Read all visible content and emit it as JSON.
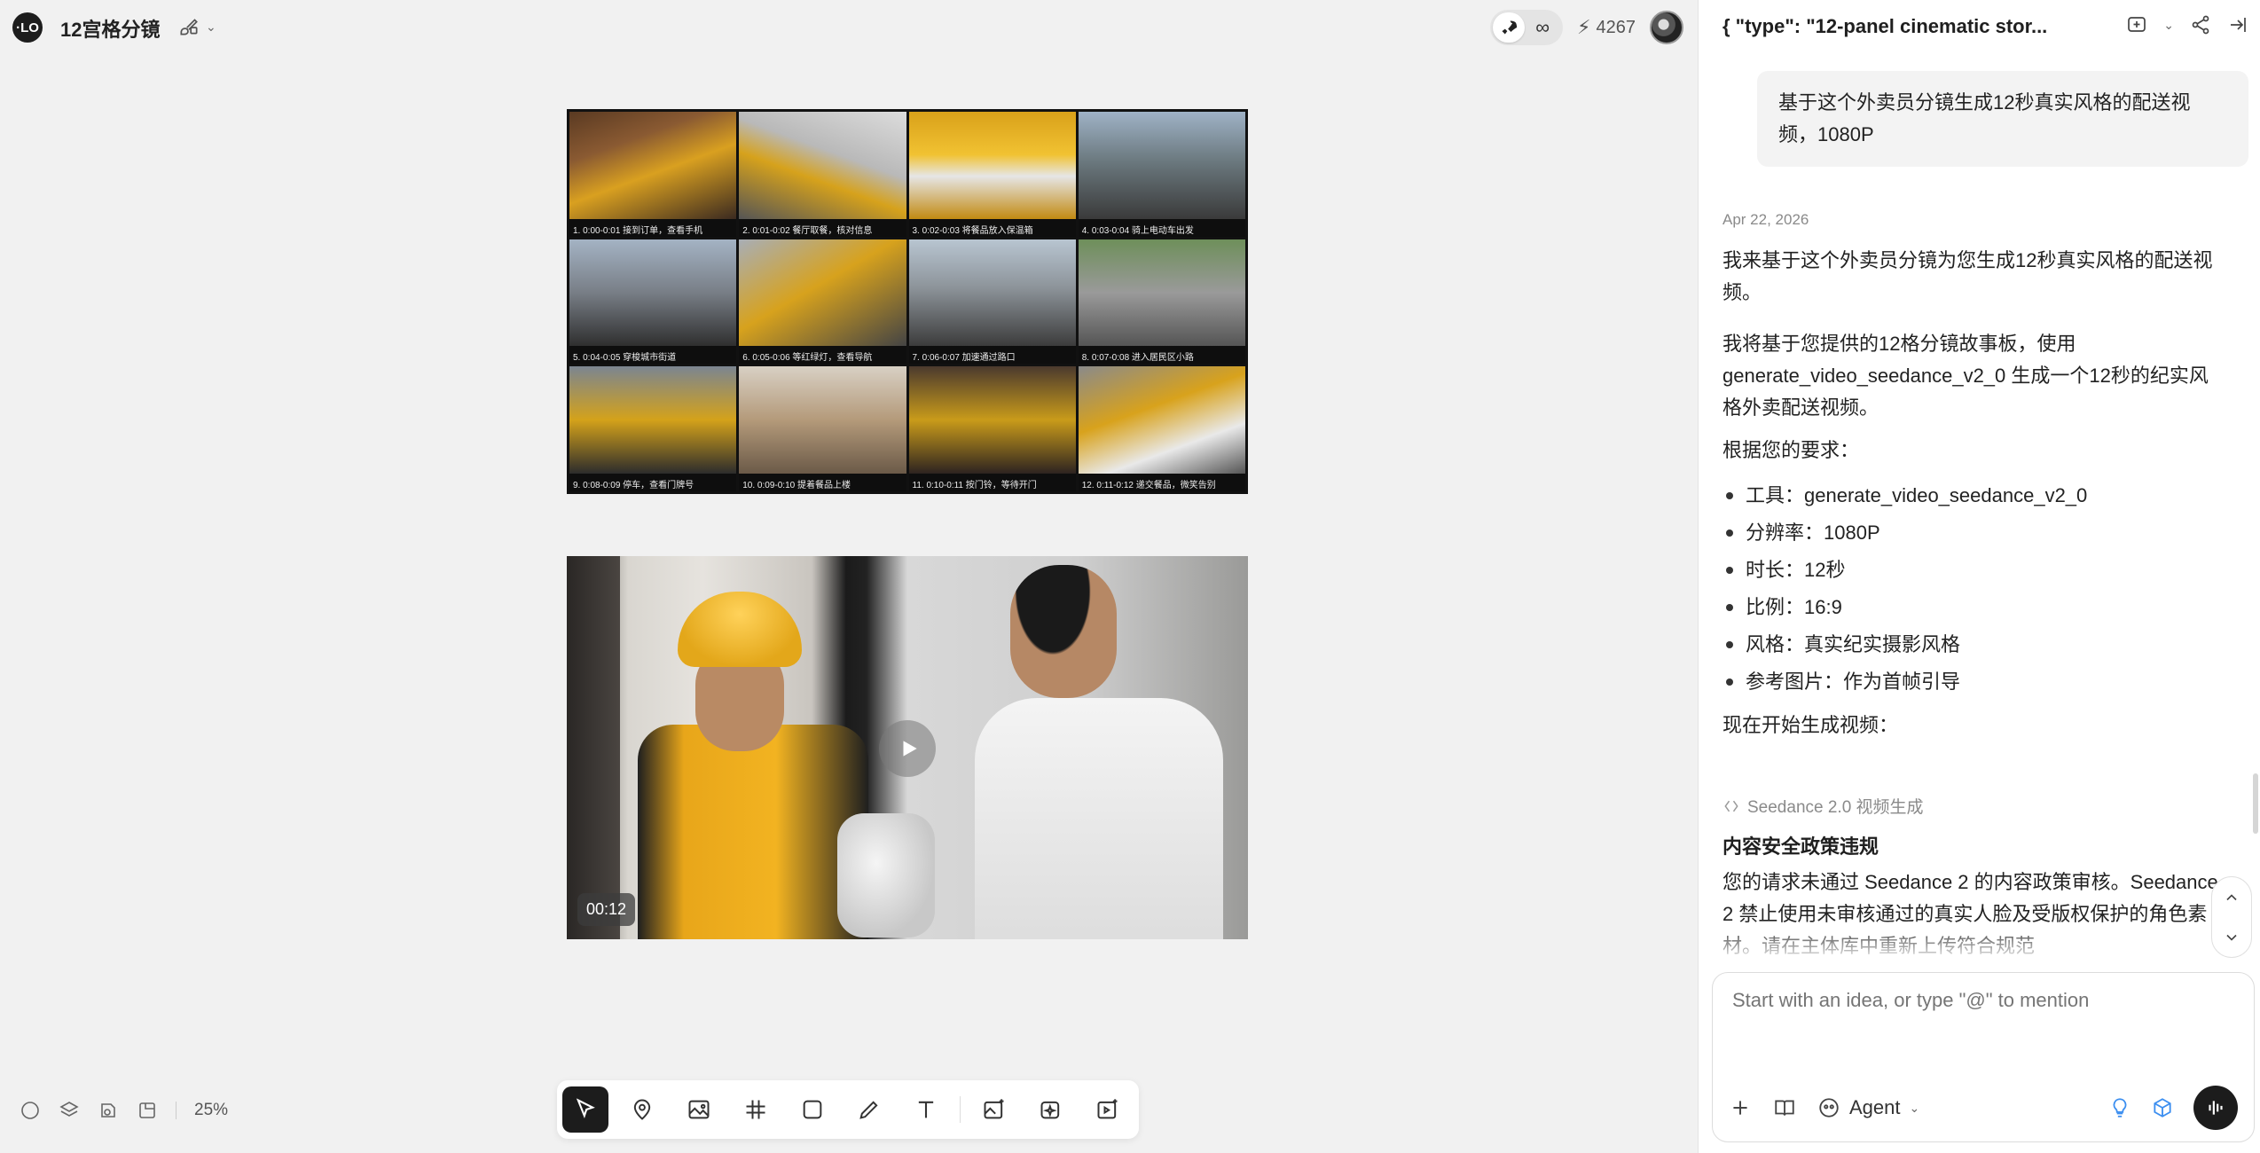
{
  "app": {
    "logo_text": "·LO",
    "project_title": "12宫格分镜"
  },
  "topbar": {
    "credits": "4267",
    "infinity": "∞"
  },
  "storyboard": {
    "panels": [
      {
        "caption": "1. 0:00-0:01  接到订单，查看手机"
      },
      {
        "caption": "2. 0:01-0:02  餐厅取餐，核对信息"
      },
      {
        "caption": "3. 0:02-0:03  将餐品放入保温箱"
      },
      {
        "caption": "4. 0:03-0:04  骑上电动车出发"
      },
      {
        "caption": "5. 0:04-0:05  穿梭城市街道"
      },
      {
        "caption": "6. 0:05-0:06  等红绿灯，查看导航"
      },
      {
        "caption": "7. 0:06-0:07  加速通过路口"
      },
      {
        "caption": "8. 0:07-0:08  进入居民区小路"
      },
      {
        "caption": "9. 0:08-0:09  停车，查看门牌号"
      },
      {
        "caption": "10. 0:09-0:10  提着餐品上楼"
      },
      {
        "caption": "11. 0:10-0:11  按门铃，等待开门"
      },
      {
        "caption": "12. 0:11-0:12  递交餐品，微笑告别"
      }
    ]
  },
  "video": {
    "duration": "00:12"
  },
  "canvas_footer": {
    "zoom": "25%"
  },
  "chat": {
    "title": "{ \"type\": \"12-panel cinematic stor...",
    "user_message": "基于这个外卖员分镜生成12秒真实风格的配送视频，1080P",
    "date": "Apr 22, 2026",
    "reply_intro": "我来基于这个外卖员分镜为您生成12秒真实风格的配送视频。",
    "reply_plan": "我将基于您提供的12格分镜故事板，使用 generate_video_seedance_v2_0 生成一个12秒的纪实风格外卖配送视频。",
    "reply_req": "根据您的要求：",
    "requirements": [
      {
        "text": "工具：generate_video_seedance_v2_0"
      },
      {
        "text": "分辨率：1080P"
      },
      {
        "text": "时长：12秒"
      },
      {
        "text": "比例：16:9"
      },
      {
        "text": "风格：真实纪实摄影风格"
      },
      {
        "text": "参考图片：作为首帧引导"
      }
    ],
    "reply_start": "现在开始生成视频：",
    "tool_tag": "Seedance 2.0 视频生成",
    "policy_title": "内容安全政策违规",
    "policy_text": "您的请求未通过 Seedance 2 的内容政策审核。Seedance 2 禁止使用未审核通过的真实人脸及受版权保护的角色素材。请在主体库中重新上传符合规范",
    "composer_placeholder": "Start with an idea, or type \"@\" to mention",
    "agent_label": "Agent"
  }
}
